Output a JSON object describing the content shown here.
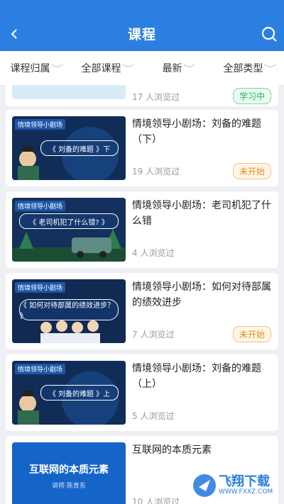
{
  "header": {
    "title": "课程",
    "back_icon": "back-icon",
    "search_icon": "search-icon"
  },
  "filters": [
    {
      "label": "课程归属"
    },
    {
      "label": "全部课程"
    },
    {
      "label": "最新"
    },
    {
      "label": "全部类型"
    }
  ],
  "courses": [
    {
      "title": "",
      "views": "17 人浏览过",
      "status": "学习中"
    },
    {
      "title": "情境领导小剧场：刘备的难题（下）",
      "views": "19 人浏览过",
      "status": "未开始",
      "thumb_tag": "情境领导小剧场",
      "thumb_banner": "《 刘备的难题 》下"
    },
    {
      "title": "情境领导小剧场：老司机犯了什么错",
      "views": "4 人浏览过",
      "status": "",
      "thumb_tag": "情境领导小剧场",
      "thumb_banner": "《 老司机犯了什么错? 》"
    },
    {
      "title": "情境领导小剧场：如何对待部属的绩效进步",
      "views": "7 人浏览过",
      "status": "未开始",
      "thumb_tag": "情境领导小剧场",
      "thumb_banner": "《 如何对待部属的绩效进步？ 》"
    },
    {
      "title": "情境领导小剧场：刘备的难题（上）",
      "views": "5 人浏览过",
      "status": "",
      "thumb_tag": "情境领导小剧场",
      "thumb_banner": "《 刘备的难题 》上"
    },
    {
      "title": "互联网的本质元素",
      "views": "10 人浏览过",
      "status": "",
      "thumb_main": "互联网的本质元素",
      "thumb_sub": "讲师 陈青东"
    }
  ],
  "watermark": {
    "text": "飞翔下载",
    "url": "WWW.FXXZ.COM"
  },
  "colors": {
    "header": "#2b7fe0",
    "learning": "#2bb36b",
    "not_started": "#e08a1e"
  }
}
